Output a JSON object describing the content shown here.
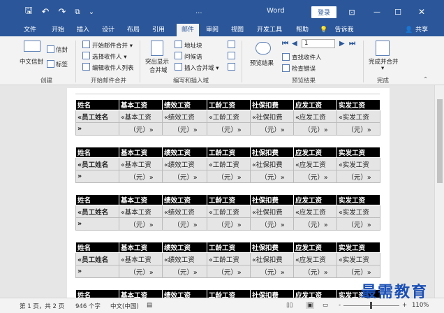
{
  "titlebar": {
    "doc_title": "...",
    "app_name": "Word",
    "login": "登录",
    "qa_icons": [
      "save-icon",
      "undo-icon",
      "redo-icon",
      "touch-mode-icon",
      "customize-icon"
    ],
    "qa_glyphs": {
      "save": "🖫",
      "undo": "↶",
      "redo": "↷",
      "touch": "⧉",
      "more": "⌄"
    },
    "win_glyphs": {
      "restore": "⊡",
      "min": "—",
      "max": "☐",
      "close": "✕"
    }
  },
  "tabs": {
    "items": [
      "文件",
      "开始",
      "插入",
      "设计",
      "布局",
      "引用",
      "邮件",
      "审阅",
      "视图",
      "开发工具",
      "帮助",
      "告诉我",
      "共享"
    ],
    "active": "邮件",
    "tell_me_icon": "lightbulb-icon",
    "share_icon": "user-icon"
  },
  "ribbon": {
    "create": {
      "envelope": "信封",
      "label": "标签",
      "chinese_envelope": "中文信封",
      "group": "创建"
    },
    "start_merge": {
      "start": "开始邮件合并 ▾",
      "select": "选择收件人 ▾",
      "edit": "编辑收件人列表",
      "group": "开始邮件合并"
    },
    "write_insert": {
      "highlight": "突出显示",
      "highlight2": "合并域",
      "address": "地址块",
      "greeting": "问候语",
      "insert_field": "插入合并域 ▾",
      "group": "编写和插入域"
    },
    "preview": {
      "preview_results": "预览结果",
      "record_value": "1",
      "find": "查找收件人",
      "check": "检查错误",
      "group": "预览结果"
    },
    "finish": {
      "finish_merge": "完成并合并",
      "group": "完成"
    }
  },
  "document": {
    "headers": [
      "姓名",
      "基本工资",
      "绩效工资",
      "工龄工资",
      "社保扣费",
      "应发工资",
      "实发工资"
    ],
    "row1": [
      "«员工姓名",
      "«基本工资",
      "«绩效工资",
      "«工龄工资",
      "«社保扣费",
      "«应发工资",
      "«实发工资"
    ],
    "row2": [
      "»",
      "（元）»",
      "（元）»",
      "（元）»",
      "（元）»",
      "（元）»",
      "（元）»"
    ]
  },
  "statusbar": {
    "page": "第 1 页，共 2 页",
    "words": "946 个字",
    "language": "中文(中国)",
    "zoom": "110%",
    "zoom_minus": "-",
    "zoom_plus": "+"
  },
  "watermark": "最需教育"
}
